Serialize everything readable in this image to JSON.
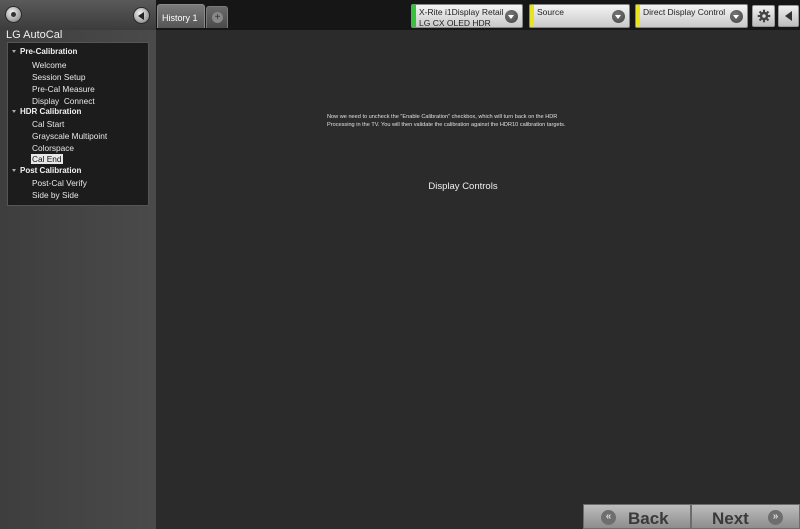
{
  "app": {
    "title": "LG AutoCal"
  },
  "sidebar": {
    "groups": [
      {
        "label": "Pre-Calibration",
        "items": [
          "Welcome",
          "Session Setup",
          "Pre-Cal Measure",
          "Display  Connect"
        ]
      },
      {
        "label": "HDR Calibration",
        "items": [
          "Cal Start",
          "Grayscale Multipoint",
          "Colorspace",
          "Cal End"
        ]
      },
      {
        "label": "Post Calibration",
        "items": [
          "Post-Cal Verify",
          "Side by Side"
        ]
      }
    ],
    "selected_item": "Cal End"
  },
  "tabs": [
    {
      "label": "History 1"
    }
  ],
  "add_tab_icon": "plus-icon",
  "meter_combo": {
    "line1": "X-Rite i1Display Retail",
    "line2": "LG CX OLED HDR",
    "accent_color": "#36c23a"
  },
  "source_combo": {
    "line1": "Source",
    "accent_color": "#e8e220"
  },
  "display_combo": {
    "line1": "Direct Display Control",
    "accent_color": "#e8e220"
  },
  "icons": {
    "settings": "gear-icon",
    "collapse": "left-triangle-icon",
    "menu": "circle-dot-icon"
  },
  "main": {
    "instruction_line1": "Now we need to uncheck the \"Enable Calibration\" checkbox, which will turn back on the HDR",
    "instruction_line2": "Processing in the TV. You will then validate the calibration against the HDR10 calibration targets.",
    "section_title": "Display Controls"
  },
  "footer": {
    "back_label": "Back",
    "next_label": "Next",
    "back_icon": "double-left-icon",
    "next_icon": "double-right-icon"
  }
}
